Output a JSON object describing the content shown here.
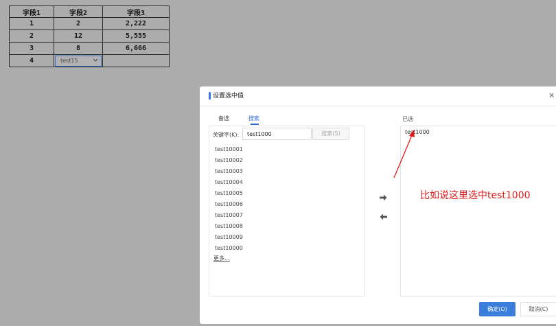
{
  "sheet": {
    "headers": [
      "字段1",
      "字段2",
      "字段3"
    ],
    "rows": [
      [
        "1",
        "2",
        "2,222"
      ],
      [
        "2",
        "12",
        "5,555"
      ],
      [
        "3",
        "8",
        "6,666"
      ]
    ],
    "row4_field1": "4",
    "row4_select_value": "test15"
  },
  "dialog": {
    "title": "设置选中值",
    "close": "×",
    "tabs": [
      "备选",
      "搜索"
    ],
    "keyword_label": "关键字(K):",
    "keyword_value": "test1000",
    "search_button": "搜索(S)",
    "options": [
      "test10001",
      "test10002",
      "test10003",
      "test10004",
      "test10005",
      "test10006",
      "test10007",
      "test10008",
      "test10009",
      "test10000"
    ],
    "more": "更多...",
    "selected_label": "已选",
    "selected_items": [
      "test1000"
    ],
    "ok_button": "确定(O)",
    "cancel_button": "取消(C)"
  },
  "annotation": {
    "text": "比如说这里选中test1000",
    "color": "#e31a1a"
  },
  "colors": {
    "accent": "#3b7ddb",
    "background": "#acacac"
  }
}
